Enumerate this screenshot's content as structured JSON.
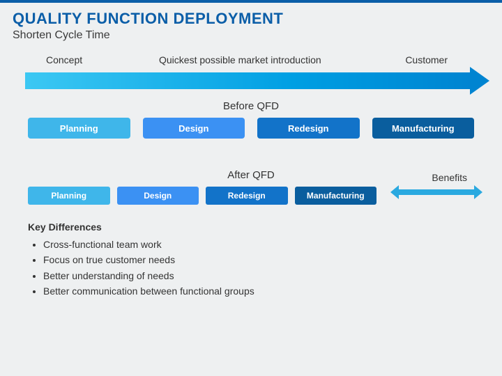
{
  "header": {
    "title": "QUALITY FUNCTION DEPLOYMENT",
    "subtitle": "Shorten Cycle Time"
  },
  "timeline": {
    "left_label": "Concept",
    "center_label": "Quickest possible market introduction",
    "right_label": "Customer"
  },
  "before": {
    "section_label": "Before QFD",
    "stages": [
      "Planning",
      "Design",
      "Redesign",
      "Manufacturing"
    ]
  },
  "after": {
    "section_label": "After QFD",
    "stages": [
      "Planning",
      "Design",
      "Redesign",
      "Manufacturing"
    ],
    "benefits_label": "Benefits"
  },
  "key_differences": {
    "heading": "Key Differences",
    "items": [
      "Cross-functional team work",
      "Focus on true customer needs",
      "Better understanding of needs",
      "Better communication between functional groups"
    ]
  }
}
